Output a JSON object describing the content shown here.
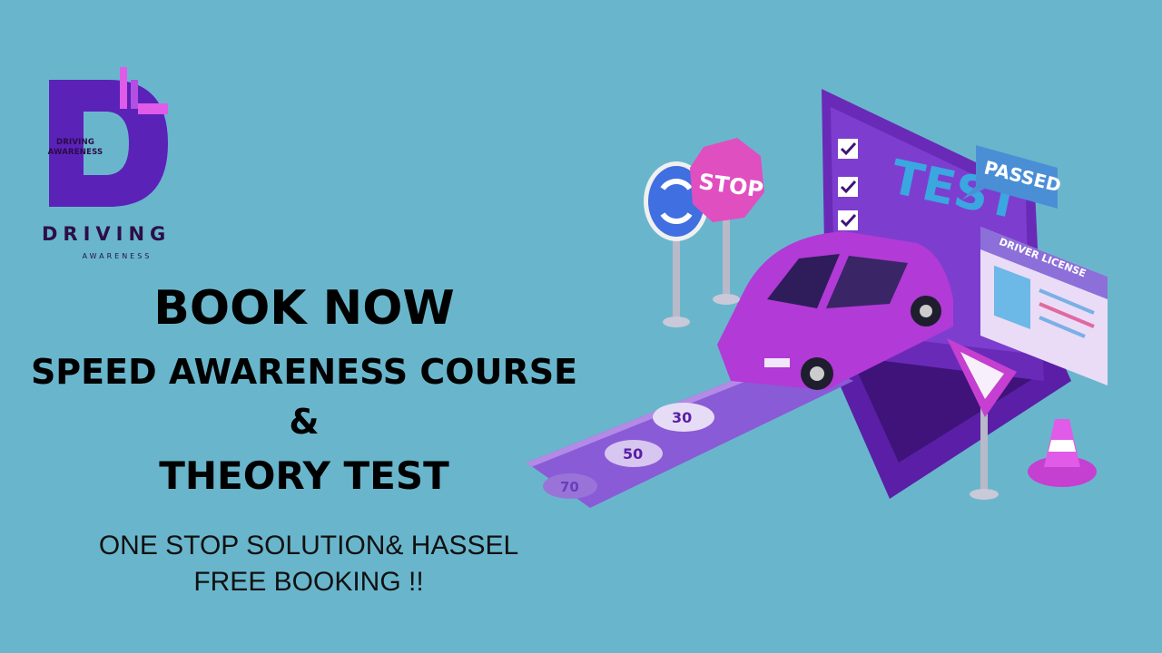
{
  "logo": {
    "small_text_line1": "DRIVING",
    "small_text_line2": "AWARENESS",
    "brand_word": "DRIVING",
    "brand_sub": "AWARENESS",
    "colors": {
      "purple": "#5b22b8",
      "pink": "#e05be7"
    }
  },
  "headline": {
    "book_now": "BOOK NOW",
    "course": "SPEED AWARENESS COURSE",
    "ampersand": "&",
    "theory": "THEORY TEST"
  },
  "tagline": {
    "line1": "ONE STOP SOLUTION& HASSEL",
    "line2": "FREE BOOKING !!"
  },
  "illustration": {
    "stop_sign": "STOP",
    "screen_title": "TEST",
    "passed_badge": "PASSED",
    "license_title": "DRIVER LICENSE",
    "road_marks": [
      "30",
      "50",
      "70"
    ],
    "icons": [
      "roundabout-sign-icon",
      "stop-sign-icon",
      "laptop-icon",
      "car-icon",
      "yield-sign-icon",
      "traffic-cone-icon",
      "driver-license-card-icon"
    ],
    "colors": {
      "background": "#69b6cc",
      "laptop": "#6a2ab8",
      "car": "#b23ad6",
      "cone": "#d94fd9"
    }
  }
}
